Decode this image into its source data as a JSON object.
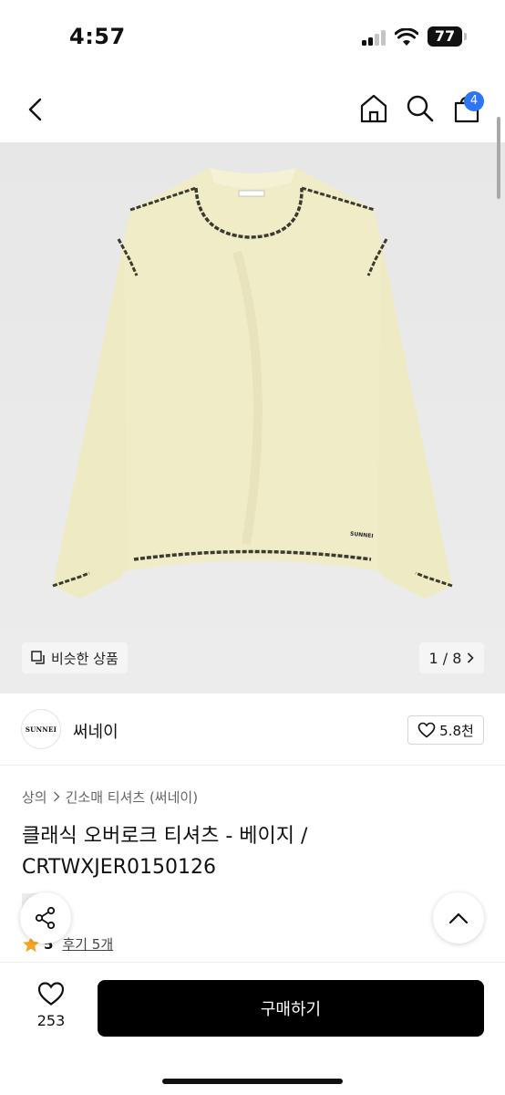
{
  "status_bar": {
    "time": "4:57",
    "battery": "77"
  },
  "header": {
    "cart_count": "4"
  },
  "gallery": {
    "similar_label": "비슷한 상품",
    "counter": "1 / 8",
    "garment_brand_mark": "SUNNEI"
  },
  "brand": {
    "logo_text": "SUNNEI",
    "name": "써네이",
    "likes": "5.8천"
  },
  "breadcrumb": {
    "category": "상의",
    "subcategory": "긴소매 티셔츠 (써네이)"
  },
  "product": {
    "title": "클래식 오버로크 티셔츠 - 베이지 / CRTWXJER0150126"
  },
  "rating": {
    "value": "5",
    "reviews": "후기 5개"
  },
  "bottom": {
    "wish_count": "253",
    "buy_label": "구매하기"
  },
  "colors": {
    "accent": "#2d76f3",
    "star": "#f5a623",
    "garment": "#eeeac4",
    "stitch": "#3a3a2e"
  }
}
